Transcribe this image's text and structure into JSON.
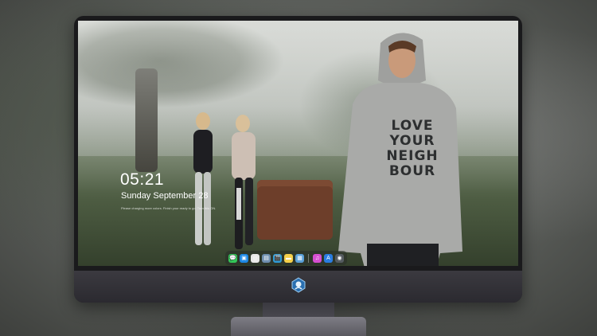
{
  "lockscreen": {
    "time": "05:21",
    "date": "Sunday September 28",
    "notification": "Please charging more colors. Finish your ready to go. Turn this ON."
  },
  "wallpaper": {
    "hoodie_lines": [
      "LOVE",
      "YOUR",
      "NEIGH",
      "BOUR"
    ]
  },
  "dock": {
    "apps": [
      {
        "name": "messages-icon",
        "color": "#34c759",
        "glyph": "💬"
      },
      {
        "name": "finder-icon",
        "color": "#1e88e5",
        "glyph": "▣"
      },
      {
        "name": "safari-icon",
        "color": "#e8e8e8",
        "glyph": "◎"
      },
      {
        "name": "preview-icon",
        "color": "#6f8fb0",
        "glyph": "▤"
      },
      {
        "name": "clapper-icon",
        "color": "#2f9bd6",
        "glyph": "🎬"
      },
      {
        "name": "notes-icon",
        "color": "#f5d04a",
        "glyph": "▬"
      },
      {
        "name": "photos-icon",
        "color": "#5aa0d8",
        "glyph": "▦"
      }
    ],
    "apps_right": [
      {
        "name": "itunes-icon",
        "color": "#d64fd1",
        "glyph": "♫"
      },
      {
        "name": "appstore-icon",
        "color": "#2a7de1",
        "glyph": "A"
      },
      {
        "name": "camera-icon",
        "color": "#555b60",
        "glyph": "◉"
      }
    ]
  },
  "colors": {
    "bezel": "#1a1a1c",
    "chin": "#2f2e34",
    "hoodie": "#a9aaa8",
    "bench": "#6d3e2a"
  }
}
